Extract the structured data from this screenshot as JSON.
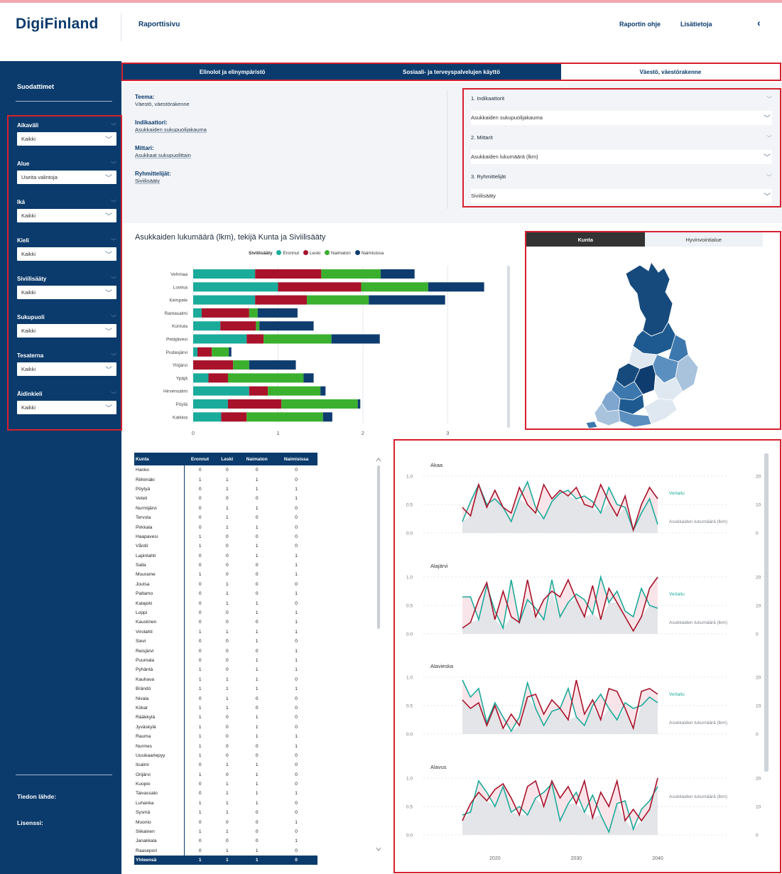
{
  "header": {
    "logo": "DigiFinland",
    "page_title": "Raporttisivu",
    "links": [
      "Raportin ohje",
      "Lisätietoja"
    ],
    "back": "‹"
  },
  "sidebar": {
    "title": "Suodattimet",
    "filters": [
      {
        "label": "Aikaväli",
        "value": "Kaikki"
      },
      {
        "label": "Alue",
        "value": "Useita valintoja"
      },
      {
        "label": "Ikä",
        "value": "Kaikki"
      },
      {
        "label": "Kieli",
        "value": "Kaikki"
      },
      {
        "label": "Siviilisääty",
        "value": "Kaikki"
      },
      {
        "label": "Sukupuoli",
        "value": "Kaikki"
      },
      {
        "label": "Tesaterna",
        "value": "Kaikki"
      },
      {
        "label": "Äidinkieli",
        "value": "Kaikki"
      }
    ],
    "footer": [
      "Tiedon lähde:",
      "Lisenssi:"
    ]
  },
  "tabs": [
    "Elinolot ja elinympäristö",
    "Sosiaali- ja terveyspalvelujen käyttö",
    "Väestö, väestörakenne"
  ],
  "info": [
    {
      "key": "Teema:",
      "value": "Väestö, väestörakenne"
    },
    {
      "key": "Indikaattori:",
      "value": "Asukkaiden sukupuolijakauma"
    },
    {
      "key": "Mittari:",
      "value": "Asukkaat sukupuolittain"
    },
    {
      "key": "Ryhmittelijät:",
      "value": "Siviilisääty"
    }
  ],
  "indicators": [
    {
      "label": "1. Indikaattorit",
      "value": "Asukkaiden sukupuolijakauma"
    },
    {
      "label": "2. Mittarit",
      "value": "Asukkaiden lukumäärä (lkm)"
    },
    {
      "label": "3. Ryhmittelijät",
      "value": "Siviilisääty"
    }
  ],
  "colors": {
    "navy": "#0b3b6c",
    "eronnut": "#1aab9b",
    "leski": "#a8122a",
    "naimaton": "#3ab02e",
    "naimisissa": "#0e3c6e",
    "red_outline": "#d6202f"
  },
  "bar_chart": {
    "title": "Asukkaiden lukumäärä (lkm), tekijä Kunta ja Siviilisääty",
    "legend_title": "Siviilisääty",
    "series_names": [
      "Eronnut",
      "Leski",
      "Naimaton",
      "Naimisissa"
    ]
  },
  "map": {
    "tabs": [
      "Kunta",
      "Hyvinvointialue"
    ]
  },
  "table": {
    "columns": [
      "Kunta",
      "Eronnut",
      "Leski",
      "Naimaton",
      "Naimisissa"
    ],
    "rows": [
      [
        "Hanko",
        "0",
        "0",
        "0",
        "0"
      ],
      [
        "Riihimäki",
        "1",
        "1",
        "1",
        "0"
      ],
      [
        "Pöytyä",
        "0",
        "1",
        "1",
        "1"
      ],
      [
        "Veteli",
        "0",
        "0",
        "0",
        "1"
      ],
      [
        "Nurmijärvi",
        "0",
        "1",
        "1",
        "0"
      ],
      [
        "Tervola",
        "0",
        "1",
        "0",
        "0"
      ],
      [
        "Pirkkala",
        "0",
        "1",
        "1",
        "0"
      ],
      [
        "Haapavesi",
        "1",
        "0",
        "0",
        "0"
      ],
      [
        "Vårdö",
        "1",
        "0",
        "1",
        "0"
      ],
      [
        "Lapinlahti",
        "0",
        "0",
        "1",
        "1"
      ],
      [
        "Salla",
        "0",
        "0",
        "0",
        "1"
      ],
      [
        "Muurame",
        "1",
        "0",
        "0",
        "1"
      ],
      [
        "Joutsa",
        "0",
        "1",
        "0",
        "0"
      ],
      [
        "Paltamo",
        "0",
        "1",
        "0",
        "1"
      ],
      [
        "Kalajoki",
        "0",
        "1",
        "1",
        "0"
      ],
      [
        "Loppi",
        "0",
        "0",
        "1",
        "1"
      ],
      [
        "Kaustinen",
        "0",
        "0",
        "0",
        "1"
      ],
      [
        "Virolahti",
        "1",
        "1",
        "1",
        "1"
      ],
      [
        "Sievi",
        "0",
        "0",
        "1",
        "0"
      ],
      [
        "Reisjärvi",
        "0",
        "0",
        "0",
        "1"
      ],
      [
        "Puumala",
        "0",
        "0",
        "1",
        "1"
      ],
      [
        "Pyhäntä",
        "1",
        "0",
        "1",
        "1"
      ],
      [
        "Kauhava",
        "1",
        "1",
        "1",
        "0"
      ],
      [
        "Brändö",
        "1",
        "1",
        "1",
        "1"
      ],
      [
        "Nivala",
        "0",
        "1",
        "0",
        "0"
      ],
      [
        "Kökar",
        "1",
        "1",
        "0",
        "0"
      ],
      [
        "Rääkkylä",
        "1",
        "0",
        "1",
        "0"
      ],
      [
        "Jyväskylä",
        "1",
        "0",
        "1",
        "0"
      ],
      [
        "Rauma",
        "1",
        "0",
        "1",
        "1"
      ],
      [
        "Nurmes",
        "1",
        "0",
        "0",
        "1"
      ],
      [
        "Uusikaarlepyy",
        "1",
        "0",
        "0",
        "0"
      ],
      [
        "Iisalmi",
        "0",
        "1",
        "1",
        "0"
      ],
      [
        "Orijärvi",
        "1",
        "0",
        "1",
        "0"
      ],
      [
        "Kuopio",
        "0",
        "1",
        "1",
        "0"
      ],
      [
        "Taivassalo",
        "0",
        "1",
        "1",
        "1"
      ],
      [
        "Luhanka",
        "1",
        "1",
        "1",
        "0"
      ],
      [
        "Sysmä",
        "1",
        "1",
        "0",
        "0"
      ],
      [
        "Muonio",
        "0",
        "0",
        "0",
        "1"
      ],
      [
        "Siikainen",
        "1",
        "1",
        "0",
        "0"
      ],
      [
        "Janakkala",
        "0",
        "0",
        "0",
        "1"
      ],
      [
        "Raasepori",
        "0",
        "1",
        "1",
        "0"
      ]
    ],
    "total": [
      "Yhteensä",
      "1",
      "1",
      "1",
      "0"
    ]
  },
  "chart_data": [
    {
      "type": "bar",
      "title": "Asukkaiden lukumäärä (lkm), tekijä Kunta ja Siviilisääty",
      "legend_title": "Siviilisääty",
      "categories": [
        "Vehmaa",
        "Loviisa",
        "Kempele",
        "Rantasalmi",
        "Kontula",
        "Petäjävesi",
        "Pudasjärvi",
        "Ylöjärvi",
        "Ypäjä",
        "Hirvensalmi",
        "Pöytä",
        "Kaikkia"
      ],
      "series": [
        {
          "name": "Eronnut",
          "values": [
            0.73,
            1.0,
            0.73,
            0.1,
            0.32,
            0.63,
            0.05,
            0.0,
            0.18,
            0.66,
            0.41,
            0.33
          ]
        },
        {
          "name": "Leski",
          "values": [
            0.78,
            0.98,
            0.61,
            0.56,
            0.42,
            0.2,
            0.17,
            0.47,
            0.23,
            0.22,
            0.63,
            0.3
          ]
        },
        {
          "name": "Naimaton",
          "values": [
            0.7,
            0.79,
            0.73,
            0.1,
            0.04,
            0.8,
            0.2,
            0.19,
            0.89,
            0.62,
            0.9,
            0.9
          ]
        },
        {
          "name": "Naimisissa",
          "values": [
            0.4,
            0.66,
            0.9,
            0.47,
            0.64,
            0.57,
            0.03,
            0.55,
            0.12,
            0.06,
            0.03,
            0.11
          ]
        }
      ],
      "xticks": [
        "0",
        "1",
        "2",
        "3"
      ],
      "xlim": [
        0,
        3.5
      ]
    },
    {
      "type": "line",
      "x": [
        2016,
        2017,
        2018,
        2019,
        2020,
        2021,
        2022,
        2023,
        2024,
        2025,
        2026,
        2027,
        2028,
        2029,
        2030,
        2031,
        2032,
        2033,
        2034,
        2035,
        2036,
        2037,
        2038,
        2039,
        2040
      ],
      "xticks": [
        "2020",
        "2030",
        "2040"
      ],
      "left_yticks": [
        "0.0",
        "0.5",
        "1.0"
      ],
      "right_yticks": [
        "0",
        "10",
        "20"
      ],
      "panels": [
        {
          "name": "Akaa",
          "labels": [
            "Vertailu",
            "Asukkaiden lukumäärä (lkm)"
          ],
          "series": [
            {
              "name": "Vertailu",
              "values": [
                0.2,
                0.55,
                0.85,
                0.5,
                0.6,
                0.45,
                0.2,
                0.6,
                0.9,
                0.45,
                0.25,
                0.55,
                0.7,
                0.75,
                0.6,
                0.65,
                0.55,
                0.35,
                0.8,
                0.5,
                0.45,
                0.05,
                0.35,
                0.6,
                0.15
              ]
            },
            {
              "name": "Asukkaiden lukumäärä (lkm)",
              "values": [
                0.45,
                0.3,
                0.85,
                0.45,
                0.75,
                0.45,
                0.35,
                0.8,
                0.5,
                0.35,
                0.85,
                0.6,
                0.75,
                0.65,
                0.8,
                0.5,
                0.45,
                0.85,
                0.55,
                0.3,
                0.65,
                0.05,
                0.5,
                0.8,
                0.6
              ]
            }
          ]
        },
        {
          "name": "Alajärvi",
          "labels": [
            "Vertailu",
            "Asukkaiden lukumäärä (lkm)"
          ],
          "series": [
            {
              "name": "Vertailu",
              "values": [
                0.65,
                0.65,
                0.25,
                0.85,
                0.4,
                0.1,
                0.95,
                0.2,
                0.6,
                0.45,
                0.25,
                0.95,
                0.3,
                0.55,
                0.7,
                0.6,
                0.35,
                1.0,
                0.55,
                0.75,
                0.4,
                0.3,
                0.8,
                0.5,
                0.45
              ]
            },
            {
              "name": "Asukkaiden lukumäärä (lkm)",
              "values": [
                0.1,
                0.2,
                0.6,
                0.9,
                0.25,
                0.75,
                0.3,
                0.2,
                0.95,
                0.3,
                0.6,
                0.75,
                0.65,
                0.95,
                0.6,
                0.3,
                0.85,
                0.25,
                0.8,
                0.55,
                0.3,
                0.05,
                0.3,
                0.8,
                1.0
              ]
            }
          ]
        },
        {
          "name": "Alavieska",
          "labels": [
            "Vertailu",
            "Asukkaiden lukumäärä (lkm)"
          ],
          "series": [
            {
              "name": "Vertailu",
              "values": [
                0.95,
                0.65,
                0.8,
                0.2,
                0.55,
                0.3,
                0.05,
                0.3,
                0.9,
                0.45,
                0.15,
                0.4,
                0.45,
                0.8,
                0.3,
                0.15,
                0.5,
                0.7,
                0.45,
                0.25,
                0.55,
                0.45,
                0.5,
                0.65,
                0.55
              ]
            },
            {
              "name": "Asukkaiden lukumäärä (lkm)",
              "values": [
                0.6,
                0.45,
                0.55,
                0.15,
                0.5,
                0.1,
                0.35,
                0.15,
                0.65,
                0.7,
                0.35,
                0.6,
                0.45,
                0.25,
                0.95,
                0.35,
                0.6,
                0.25,
                0.8,
                0.75,
                0.45,
                0.1,
                0.75,
                0.8,
                0.7
              ]
            }
          ]
        },
        {
          "name": "Alavus",
          "labels": [
            "Asukkaiden lukumäärä (lkm)"
          ],
          "series": [
            {
              "name": "Vertailu",
              "values": [
                0.35,
                0.4,
                0.95,
                0.75,
                0.5,
                0.85,
                0.4,
                0.5,
                0.35,
                0.65,
                0.75,
                0.9,
                0.25,
                0.55,
                0.75,
                0.4,
                0.7,
                0.35,
                0.05,
                0.55,
                0.6,
                0.1,
                0.45,
                0.6,
                0.85
              ]
            },
            {
              "name": "Asukkaiden lukumäärä (lkm)",
              "values": [
                0.25,
                0.55,
                0.75,
                0.6,
                0.8,
                0.9,
                0.65,
                0.35,
                0.85,
                0.95,
                0.5,
                0.95,
                0.65,
                0.85,
                0.55,
                0.95,
                0.3,
                0.75,
                0.5,
                0.95,
                0.25,
                0.45,
                0.25,
                0.45,
                1.0
              ]
            }
          ]
        }
      ]
    }
  ]
}
